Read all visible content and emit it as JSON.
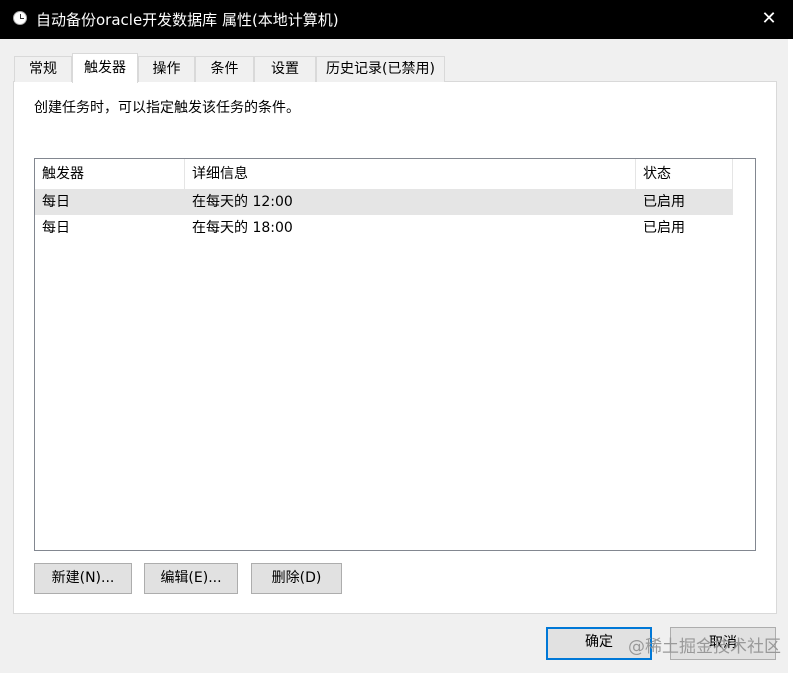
{
  "window": {
    "title": "自动备份oracle开发数据库 属性(本地计算机)",
    "icon": "clock-icon",
    "close_glyph": "✕"
  },
  "tabs": [
    {
      "label": "常规",
      "active": false
    },
    {
      "label": "触发器",
      "active": true
    },
    {
      "label": "操作",
      "active": false
    },
    {
      "label": "条件",
      "active": false
    },
    {
      "label": "设置",
      "active": false
    },
    {
      "label": "历史记录(已禁用)",
      "active": false
    }
  ],
  "main": {
    "description": "创建任务时，可以指定触发该任务的条件。",
    "columns": [
      "触发器",
      "详细信息",
      "状态"
    ],
    "rows": [
      {
        "trigger": "每日",
        "details": "在每天的 12:00",
        "status": "已启用",
        "selected": true
      },
      {
        "trigger": "每日",
        "details": "在每天的 18:00",
        "status": "已启用",
        "selected": false
      }
    ],
    "buttons": {
      "new": "新建(N)...",
      "edit": "编辑(E)...",
      "delete": "删除(D)"
    }
  },
  "footer": {
    "ok": "确定",
    "cancel": "取消"
  },
  "watermark": "@稀土掘金技术社区",
  "colors": {
    "titlebar": "#000000",
    "selected_row": "#e5e5e5",
    "default_button_border": "#0078d7"
  }
}
